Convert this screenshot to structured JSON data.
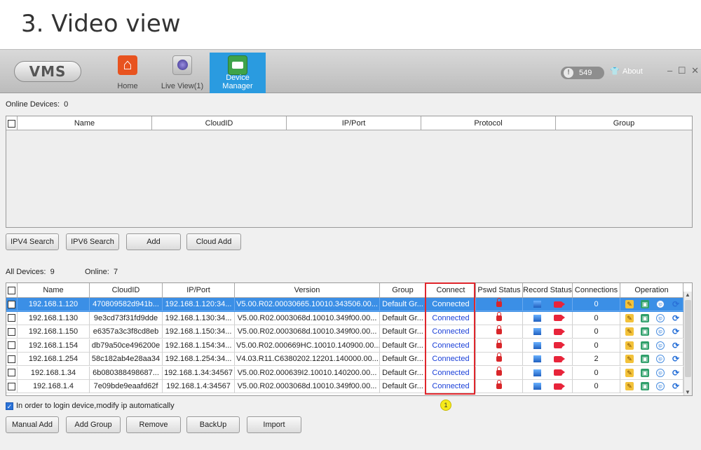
{
  "page_heading": "3. Video view",
  "app": {
    "logo": "VMS",
    "nav": [
      {
        "label": "Home"
      },
      {
        "label": "Live View(1)"
      },
      {
        "label": "Device Manager"
      }
    ],
    "badge_count": "549",
    "about": "About",
    "win_controls": "– ☐ ✕"
  },
  "online": {
    "label": "Online Devices:",
    "count": "0",
    "columns": [
      "Name",
      "CloudID",
      "IP/Port",
      "Protocol",
      "Group"
    ]
  },
  "search_buttons": [
    "IPV4 Search",
    "IPV6 Search",
    "Add",
    "Cloud Add"
  ],
  "all_devices": {
    "label": "All Devices:",
    "count": "9",
    "online_label": "Online:",
    "online_count": "7",
    "columns": [
      "Name",
      "CloudID",
      "IP/Port",
      "Version",
      "Group",
      "Connect",
      "Pswd Status",
      "Record Status",
      "Connections",
      "Operation"
    ],
    "rows": [
      {
        "name": "192.168.1.120",
        "cloudid": "470809582d941b...",
        "ip": "192.168.1.120:34...",
        "version": "V5.00.R02.00030665.10010.343506.00...",
        "group": "Default Gr...",
        "connect": "Connected",
        "connections": "0"
      },
      {
        "name": "192.168.1.130",
        "cloudid": "9e3cd73f31fd9dde",
        "ip": "192.168.1.130:34...",
        "version": "V5.00.R02.0003068d.10010.349f00.00...",
        "group": "Default Gr...",
        "connect": "Connected",
        "connections": "0"
      },
      {
        "name": "192.168.1.150",
        "cloudid": "e6357a3c3f8cd8eb",
        "ip": "192.168.1.150:34...",
        "version": "V5.00.R02.0003068d.10010.349f00.00...",
        "group": "Default Gr...",
        "connect": "Connected",
        "connections": "0"
      },
      {
        "name": "192.168.1.154",
        "cloudid": "db79a50ce496200e",
        "ip": "192.168.1.154:34...",
        "version": "V5.00.R02.000669HC.10010.140900.00...",
        "group": "Default Gr...",
        "connect": "Connected",
        "connections": "0"
      },
      {
        "name": "192.168.1.254",
        "cloudid": "58c182ab4e28aa34",
        "ip": "192.168.1.254:34...",
        "version": "V4.03.R11.C6380202.12201.140000.00...",
        "group": "Default Gr...",
        "connect": "Connected",
        "connections": "2"
      },
      {
        "name": "192.168.1.34",
        "cloudid": "6b080388498687...",
        "ip": "192.168.1.34:34567",
        "version": "V5.00.R02.000639I2.10010.140200.00...",
        "group": "Default Gr...",
        "connect": "Connected",
        "connections": "0"
      },
      {
        "name": "192.168.1.4",
        "cloudid": "7e09bde9eaafd62f",
        "ip": "192.168.1.4:34567",
        "version": "V5.00.R02.0003068d.10010.349f00.00...",
        "group": "Default Gr...",
        "connect": "Connected",
        "connections": "0"
      }
    ]
  },
  "marker": "1",
  "auto_login_text": "In order to login device,modify ip automatically",
  "bottom_buttons": [
    "Manual Add",
    "Add Group",
    "Remove",
    "BackUp",
    "Import"
  ],
  "colors": {
    "accent": "#2a9be0",
    "selected_row": "#3b8fe6",
    "connected_text": "#1a3fd8",
    "highlight_border": "#e0262c"
  }
}
